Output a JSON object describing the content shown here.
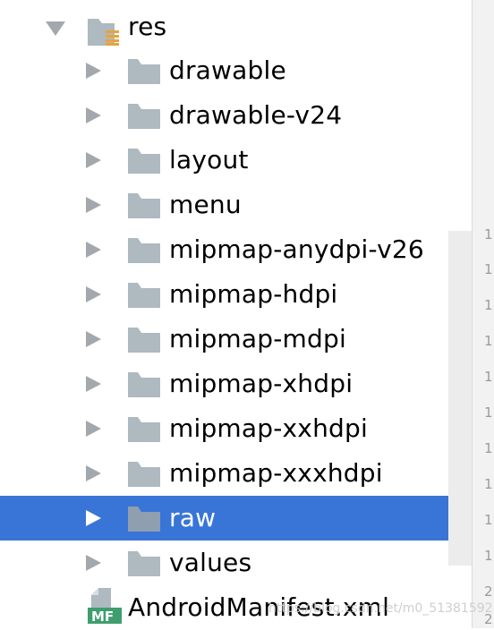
{
  "tree": {
    "root": {
      "label": "res",
      "icon": "resource-folder-icon",
      "expanded": true
    },
    "folders": [
      {
        "label": "drawable",
        "icon": "folder-icon",
        "expanded": false,
        "selected": false
      },
      {
        "label": "drawable-v24",
        "icon": "folder-icon",
        "expanded": false,
        "selected": false
      },
      {
        "label": "layout",
        "icon": "folder-icon",
        "expanded": false,
        "selected": false
      },
      {
        "label": "menu",
        "icon": "folder-icon",
        "expanded": false,
        "selected": false
      },
      {
        "label": "mipmap-anydpi-v26",
        "icon": "folder-icon",
        "expanded": false,
        "selected": false
      },
      {
        "label": "mipmap-hdpi",
        "icon": "folder-icon",
        "expanded": false,
        "selected": false
      },
      {
        "label": "mipmap-mdpi",
        "icon": "folder-icon",
        "expanded": false,
        "selected": false
      },
      {
        "label": "mipmap-xhdpi",
        "icon": "folder-icon",
        "expanded": false,
        "selected": false
      },
      {
        "label": "mipmap-xxhdpi",
        "icon": "folder-icon",
        "expanded": false,
        "selected": false
      },
      {
        "label": "mipmap-xxxhdpi",
        "icon": "folder-icon",
        "expanded": false,
        "selected": false
      },
      {
        "label": "raw",
        "icon": "folder-icon",
        "expanded": false,
        "selected": true
      },
      {
        "label": "values",
        "icon": "folder-icon",
        "expanded": false,
        "selected": false
      }
    ],
    "manifest": {
      "label": "AndroidManifest.xml",
      "icon": "manifest-file-icon",
      "badge": "MF"
    }
  },
  "gutter_line_numbers": [
    "1",
    "1",
    "1",
    "1",
    "1",
    "1",
    "1",
    "1",
    "1",
    "1",
    "1",
    "1",
    "2",
    "2"
  ],
  "watermark": "https://blog.csdn.net/m0_51381592",
  "colors": {
    "selection": "#3875d7",
    "folder": "#aeb9c0",
    "arrow": "#a3a8ad",
    "manifest_badge": "#3f9e6e",
    "resource_lines": "#e8a33d"
  }
}
